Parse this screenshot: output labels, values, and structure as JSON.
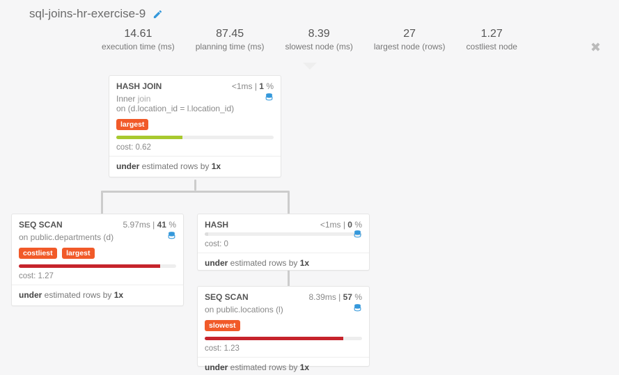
{
  "title": "sql-joins-hr-exercise-9",
  "metrics": [
    {
      "value": "14.61",
      "label": "execution time (ms)"
    },
    {
      "value": "87.45",
      "label": "planning time (ms)"
    },
    {
      "value": "8.39",
      "label": "slowest node (ms)"
    },
    {
      "value": "27",
      "label": "largest node (rows)"
    },
    {
      "value": "1.27",
      "label": "costliest node"
    }
  ],
  "labels": {
    "cost_prefix": "cost: ",
    "under": "under",
    "estimated_suffix": " estimated rows by ",
    "by_val": "1x",
    "inner": "Inner",
    "join": "join",
    "on_prefix1": "on (d.location_id = l.location_id)",
    "on_dep": "on public.departments (d)",
    "on_loc": "on public.locations (l)"
  },
  "nodes": {
    "hashjoin": {
      "name": "HASH JOIN",
      "time": "<1ms",
      "pct": "1",
      "badges": [
        "largest"
      ],
      "bar_pct": 42,
      "bar_color": "green",
      "cost": "0.62"
    },
    "seqscan1": {
      "name": "SEQ SCAN",
      "time": "5.97ms",
      "pct": "41",
      "badges": [
        "costliest",
        "largest"
      ],
      "bar_pct": 90,
      "bar_color": "red",
      "cost": "1.27"
    },
    "hash": {
      "name": "HASH",
      "time": "<1ms",
      "pct": "0",
      "badges": [],
      "bar_pct": 2,
      "bar_color": "grey",
      "cost": "0"
    },
    "seqscan2": {
      "name": "SEQ SCAN",
      "time": "8.39ms",
      "pct": "57",
      "badges": [
        "slowest"
      ],
      "bar_pct": 88,
      "bar_color": "red",
      "cost": "1.23"
    }
  }
}
